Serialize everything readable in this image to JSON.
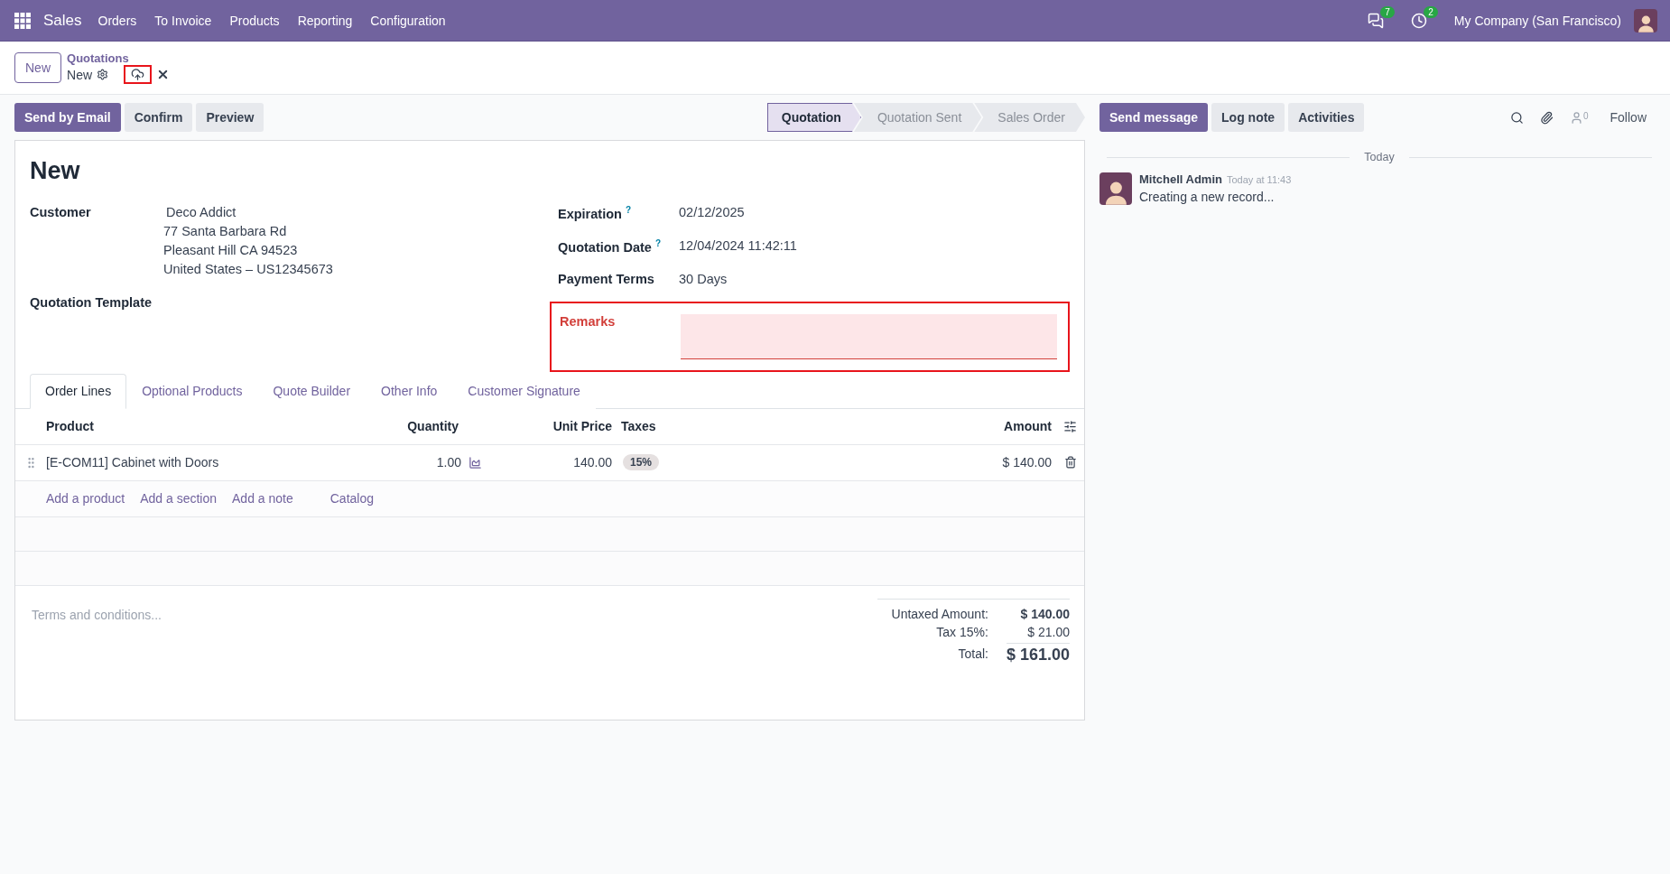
{
  "navbar": {
    "app": "Sales",
    "menu": [
      "Orders",
      "To Invoice",
      "Products",
      "Reporting",
      "Configuration"
    ],
    "messages_count": "7",
    "activities_count": "2",
    "company": "My Company (San Francisco)"
  },
  "control_panel": {
    "new_button": "New",
    "breadcrumb_parent": "Quotations",
    "breadcrumb_current": "New",
    "save_highlighted": true
  },
  "actions": [
    {
      "label": "Send by Email",
      "kind": "primary"
    },
    {
      "label": "Confirm",
      "kind": "secondary"
    },
    {
      "label": "Preview",
      "kind": "secondary"
    }
  ],
  "stages": [
    {
      "label": "Quotation",
      "selected": true
    },
    {
      "label": "Quotation Sent",
      "selected": false
    },
    {
      "label": "Sales Order",
      "selected": false
    }
  ],
  "form": {
    "title": "New",
    "left_fields": [
      {
        "label": "Customer",
        "lines": [
          "Deco Addict",
          "77 Santa Barbara Rd",
          "Pleasant Hill CA 94523",
          "United States – US12345673"
        ]
      },
      {
        "label": "Quotation Template"
      }
    ],
    "right_fields": [
      {
        "label": "Expiration",
        "help": "?",
        "value": "02/12/2025"
      },
      {
        "label": "Quotation Date",
        "help": "?",
        "value": "12/04/2024 11:42:11"
      },
      {
        "label": "Payment Terms",
        "value": "30 Days"
      }
    ],
    "remarks": {
      "label": "Remarks",
      "invalid": true,
      "highlighted": true
    },
    "tabs": [
      {
        "label": "Order Lines",
        "selected": true
      },
      {
        "label": "Optional Products",
        "selected": false
      },
      {
        "label": "Quote Builder",
        "selected": false
      },
      {
        "label": "Other Info",
        "selected": false
      },
      {
        "label": "Customer Signature",
        "selected": false
      }
    ],
    "columns": {
      "product": "Product",
      "quantity": "Quantity",
      "unit_price": "Unit Price",
      "taxes": "Taxes",
      "amount": "Amount"
    },
    "rows": [
      {
        "product": "[E-COM11] Cabinet with Doors",
        "quantity": "1.00",
        "unit_price": "140.00",
        "tax": "15%",
        "amount": "$ 140.00"
      }
    ],
    "add_links": [
      "Add a product",
      "Add a section",
      "Add a note",
      "Catalog"
    ],
    "terms_placeholder": "Terms and conditions...",
    "totals": [
      {
        "label": "Untaxed Amount:",
        "value": "$ 140.00",
        "kind": "bold"
      },
      {
        "label": "Tax 15%:",
        "value": "$ 21.00",
        "kind": "plain"
      },
      {
        "label": "Total:",
        "value": "$ 161.00",
        "kind": "total"
      }
    ]
  },
  "chatter": {
    "buttons": [
      {
        "label": "Send message",
        "kind": "primary"
      },
      {
        "label": "Log note",
        "kind": "secondary"
      },
      {
        "label": "Activities",
        "kind": "secondary"
      }
    ],
    "followers_count": "0",
    "follow": "Follow",
    "date": "Today",
    "messages": [
      {
        "author": "Mitchell Admin",
        "time": "Today at 11:43",
        "body": "Creating a new record..."
      }
    ]
  }
}
